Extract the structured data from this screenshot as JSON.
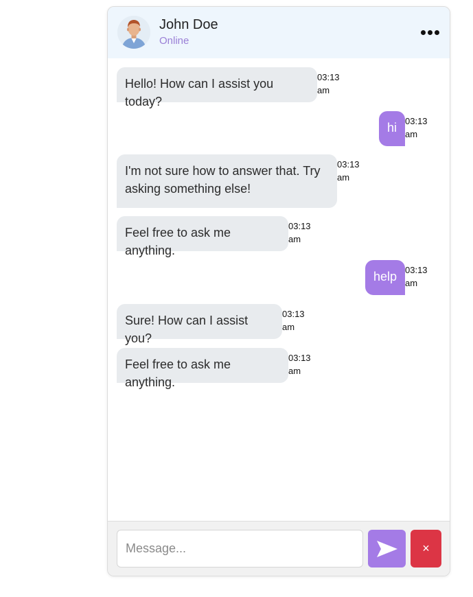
{
  "header": {
    "name": "John Doe",
    "status": "Online",
    "avatar_icon": "person-avatar"
  },
  "colors": {
    "user_bubble": "#a47be6",
    "bot_bubble": "#e8ebee",
    "status_text": "#9a7fd6",
    "header_bg": "#eef6fd",
    "close_button": "#dc3545"
  },
  "messages": [
    {
      "sender": "bot",
      "text": "Hello! How can I assist you today?",
      "time": "03:13 am"
    },
    {
      "sender": "user",
      "text": "hi",
      "time": "03:13 am"
    },
    {
      "sender": "bot",
      "text": "I'm not sure how to answer that. Try asking something else!",
      "time": "03:13 am"
    },
    {
      "sender": "bot",
      "text": "Feel free to ask me anything.",
      "time": "03:13 am"
    },
    {
      "sender": "user",
      "text": "help",
      "time": "03:13 am"
    },
    {
      "sender": "bot",
      "text": "Sure! How can I assist you?",
      "time": "03:13 am"
    },
    {
      "sender": "bot",
      "text": "Feel free to ask me anything.",
      "time": "03:13 am"
    }
  ],
  "composer": {
    "placeholder": "Message...",
    "value": "",
    "send_icon": "send-icon",
    "close_label": "×"
  },
  "menu_icon": "more-options-icon"
}
